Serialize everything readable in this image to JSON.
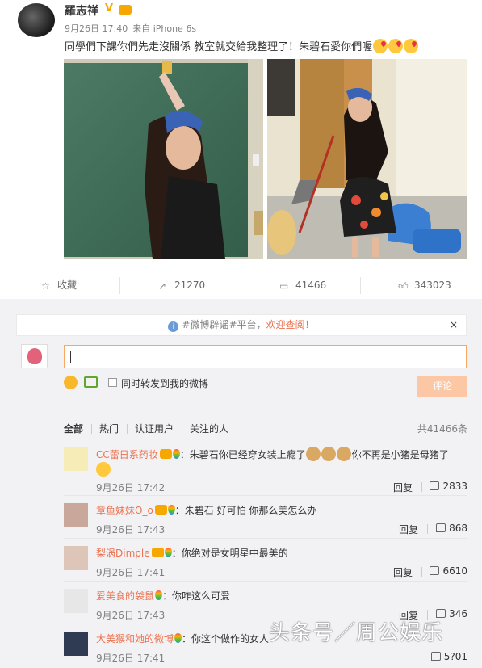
{
  "post": {
    "username": "羅志祥",
    "verified_icon": "V",
    "time": "9月26日 17:40",
    "source": "来自 iPhone 6s",
    "text": "同學們下課你們先走沒關係 教室就交給我整理了！朱碧石愛你們喔",
    "images": [
      "photo-chalkboard",
      "photo-mopping"
    ]
  },
  "actions": {
    "favorite": "收藏",
    "repost": "21270",
    "comment": "41466",
    "like": "343023"
  },
  "comments": {
    "notice_prefix": "#微博辟谣#平台，",
    "notice_highlight": "欢迎查阅！",
    "close": "×",
    "input_value": "",
    "also_repost": "同时转发到我的微博",
    "submit": "评论",
    "filters": [
      "全部",
      "热门",
      "认证用户",
      "关注的人"
    ],
    "total": "共41466条",
    "reply_label": "回复",
    "items": [
      {
        "nick": "CC蕾日系药妆",
        "text_a": "：朱碧石你已经穿女装上瘾了",
        "text_b": "你不再是小猪是母猪了",
        "time": "9月26日 17:42",
        "likes": "2833"
      },
      {
        "nick": "章鱼妹妹O_o",
        "text_a": "：朱碧石 好可怕 你那么美怎么办",
        "time": "9月26日 17:43",
        "likes": "868"
      },
      {
        "nick": "梨涡Dimple",
        "text_a": "：你绝对是女明星中最美的",
        "time": "9月26日 17:41",
        "likes": "6610"
      },
      {
        "nick": "爱美食的袋鼠",
        "text_a": "：你咋这么可爱",
        "time": "9月26日 17:43",
        "likes": "346"
      },
      {
        "nick": "大美猴和她的微博",
        "text_a": "：你这个做作的女人",
        "time": "9月26日 17:41",
        "likes": "5?01"
      }
    ]
  },
  "watermark": "头条号／周公娱乐",
  "colors": {
    "accent": "#eb7350",
    "input_border": "#f6a864",
    "submit_bg": "#fcc7a4",
    "badge": "#f6a800"
  }
}
